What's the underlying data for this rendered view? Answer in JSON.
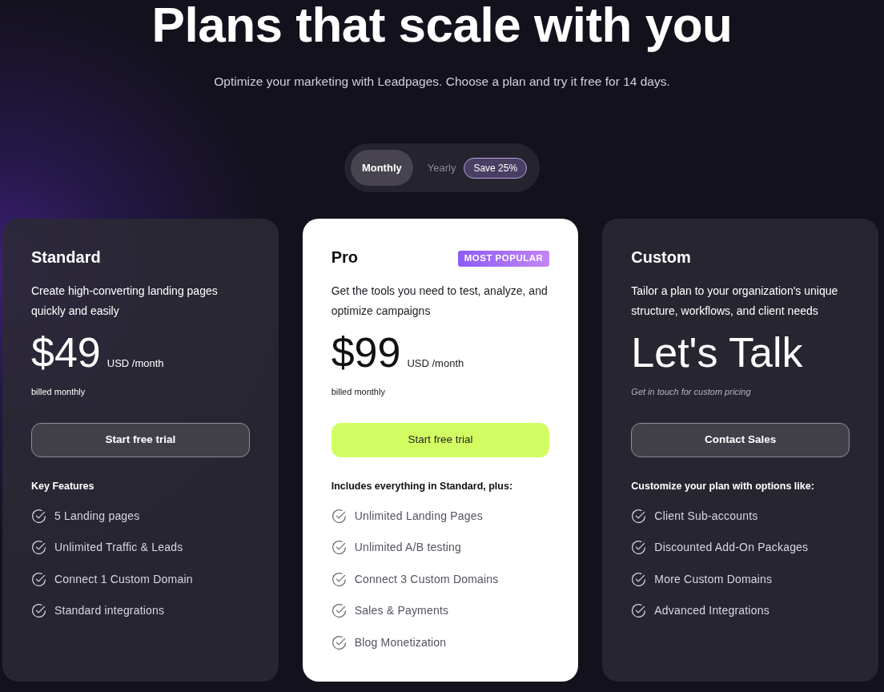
{
  "header": {
    "title": "Plans that scale with you",
    "subtitle": "Optimize your marketing with Leadpages. Choose a plan and try it free for 14 days."
  },
  "billing_toggle": {
    "options": [
      {
        "label": "Monthly",
        "selected": true
      },
      {
        "label": "Yearly",
        "selected": false,
        "badge": "Save 25%"
      }
    ]
  },
  "plans": [
    {
      "name": "Standard",
      "highlighted": false,
      "description": "Create high-converting landing pages quickly and easily",
      "price": {
        "kind": "amount",
        "value": "$49",
        "unit": "USD /month",
        "note": "billed monthly"
      },
      "button": "Start free trial",
      "features": {
        "heading": "Key Features",
        "items": [
          "5 Landing pages",
          "Unlimited Traffic & Leads",
          "Connect 1 Custom Domain",
          "Standard integrations"
        ]
      }
    },
    {
      "name": "Pro",
      "highlighted": true,
      "badge": "MOST POPULAR",
      "description": "Get the tools you need to test, analyze, and optimize campaigns",
      "price": {
        "kind": "amount",
        "value": "$99",
        "unit": "USD /month",
        "note": "billed monthly"
      },
      "button": "Start free trial",
      "features": {
        "heading": "Includes everything in Standard, plus:",
        "items": [
          "Unlimited Landing Pages",
          "Unlimited A/B testing",
          "Connect 3 Custom Domains",
          "Sales & Payments",
          "Blog Monetization"
        ]
      }
    },
    {
      "name": "Custom",
      "highlighted": false,
      "description": "Tailor a plan to your organization's unique structure, workflows, and client needs",
      "price": {
        "kind": "quote",
        "value": "Let's Talk",
        "note": "Get in touch for custom pricing"
      },
      "button": "Contact Sales",
      "features": {
        "heading": "Customize your plan with options like:",
        "items": [
          "Client Sub-accounts",
          "Discounted Add-On Packages",
          "More Custom Domains",
          "Advanced Integrations"
        ]
      }
    }
  ]
}
